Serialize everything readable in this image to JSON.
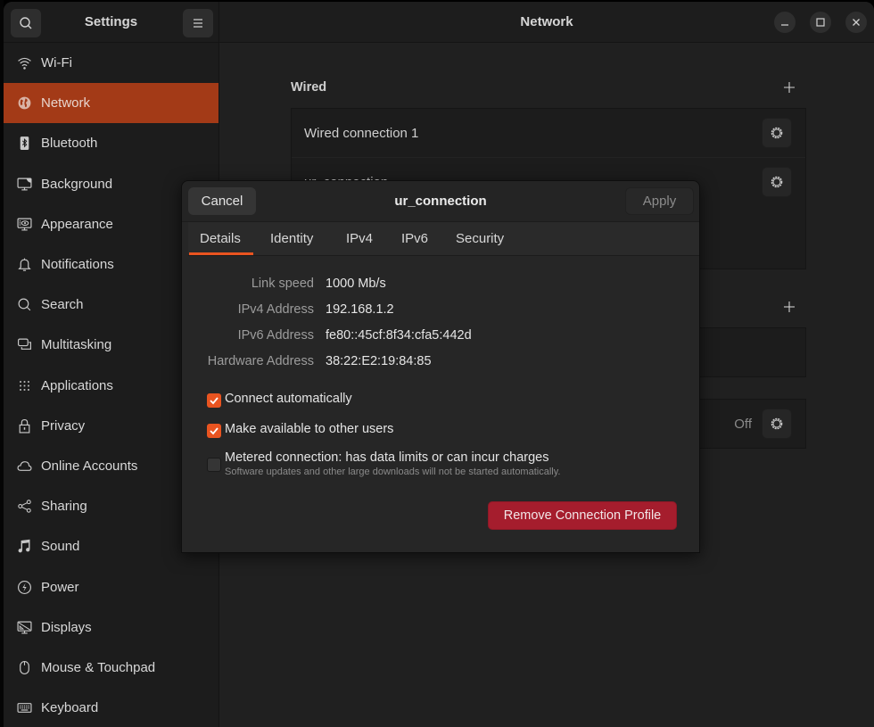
{
  "sidebar": {
    "title": "Settings",
    "search_icon": "search-icon",
    "menu_icon": "hamburger-menu-icon",
    "items": [
      {
        "label": "Wi-Fi",
        "icon": "wifi-icon",
        "active": false
      },
      {
        "label": "Network",
        "icon": "globe-icon",
        "active": true
      },
      {
        "label": "Bluetooth",
        "icon": "bluetooth-icon",
        "active": false
      },
      {
        "label": "Background",
        "icon": "background-icon",
        "active": false
      },
      {
        "label": "Appearance",
        "icon": "appearance-icon",
        "active": false
      },
      {
        "label": "Notifications",
        "icon": "bell-icon",
        "active": false
      },
      {
        "label": "Search",
        "icon": "search-icon",
        "active": false
      },
      {
        "label": "Multitasking",
        "icon": "multitasking-icon",
        "active": false
      },
      {
        "label": "Applications",
        "icon": "grid-icon",
        "active": false
      },
      {
        "label": "Privacy",
        "icon": "lock-icon",
        "active": false
      },
      {
        "label": "Online Accounts",
        "icon": "cloud-icon",
        "active": false
      },
      {
        "label": "Sharing",
        "icon": "share-icon",
        "active": false
      },
      {
        "label": "Sound",
        "icon": "music-note-icon",
        "active": false
      },
      {
        "label": "Power",
        "icon": "power-icon",
        "active": false
      },
      {
        "label": "Displays",
        "icon": "display-icon",
        "active": false
      },
      {
        "label": "Mouse & Touchpad",
        "icon": "mouse-icon",
        "active": false
      },
      {
        "label": "Keyboard",
        "icon": "keyboard-icon",
        "active": false
      }
    ]
  },
  "main": {
    "title": "Network",
    "window_controls": [
      "minimize",
      "maximize",
      "close"
    ],
    "wired": {
      "title": "Wired",
      "connections": [
        {
          "name": "Wired connection 1"
        },
        {
          "name": "ur_connection"
        }
      ]
    },
    "proxy": {
      "status": "Off"
    }
  },
  "dialog": {
    "title": "ur_connection",
    "cancel_label": "Cancel",
    "apply_label": "Apply",
    "tabs": [
      "Details",
      "Identity",
      "IPv4",
      "IPv6",
      "Security"
    ],
    "active_tab": "Details",
    "details": [
      {
        "label": "Link speed",
        "value": "1000 Mb/s"
      },
      {
        "label": "IPv4 Address",
        "value": "192.168.1.2"
      },
      {
        "label": "IPv6 Address",
        "value": "fe80::45cf:8f34:cfa5:442d"
      },
      {
        "label": "Hardware Address",
        "value": "38:22:E2:19:84:85"
      }
    ],
    "options": [
      {
        "label": "Connect automatically",
        "checked": true,
        "sub": ""
      },
      {
        "label": "Make available to other users",
        "checked": true,
        "sub": ""
      },
      {
        "label": "Metered connection: has data limits or can incur charges",
        "checked": false,
        "sub": "Software updates and other large downloads will not be started automatically."
      }
    ],
    "remove_label": "Remove Connection Profile"
  },
  "colors": {
    "accent": "#e95420",
    "sidebar_active": "#a33a17",
    "destructive": "#a51d2d"
  }
}
